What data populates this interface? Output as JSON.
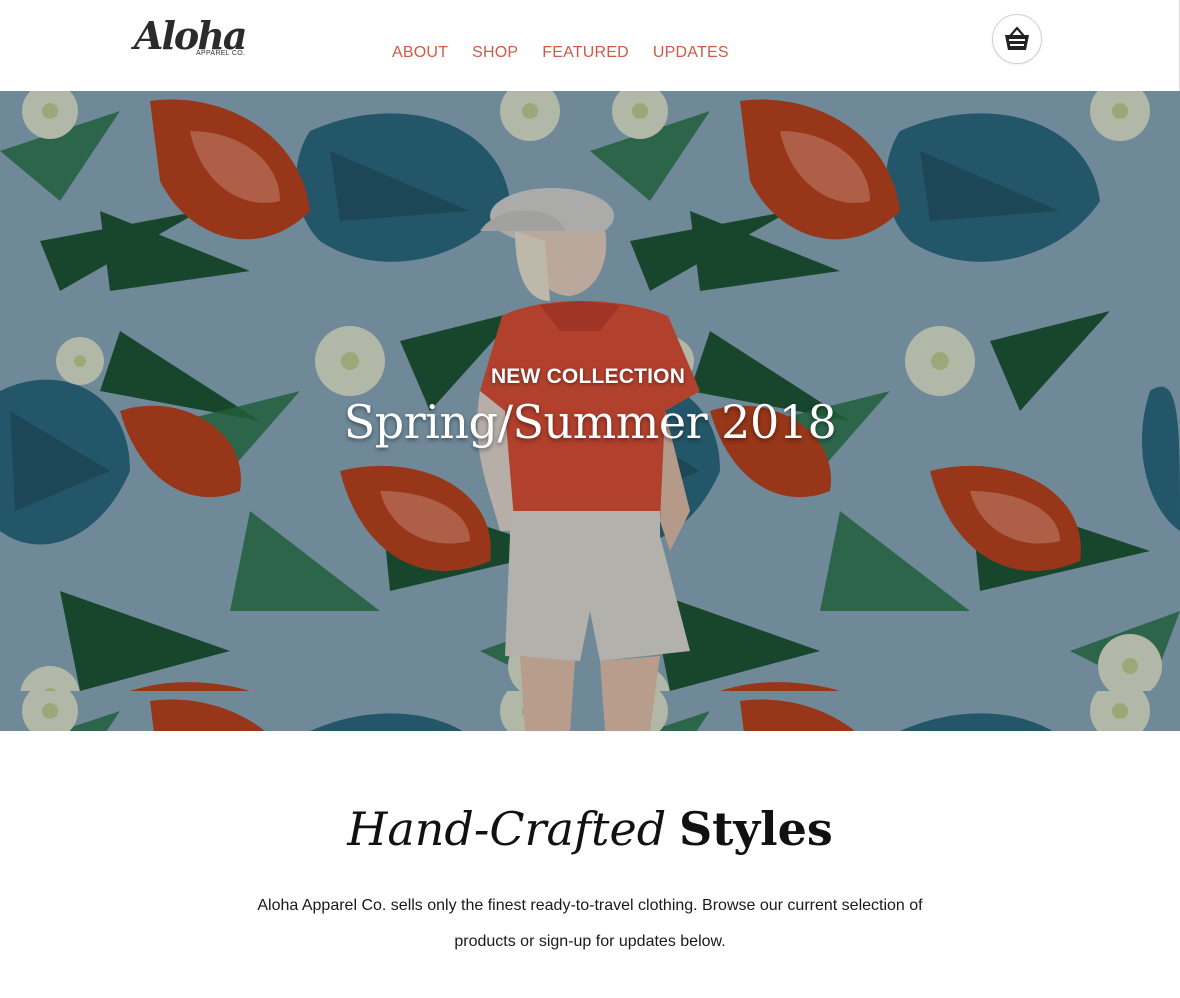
{
  "brand": {
    "name": "Aloha",
    "subtitle": "APPAREL CO."
  },
  "nav": {
    "items": [
      {
        "label": "ABOUT"
      },
      {
        "label": "SHOP"
      },
      {
        "label": "FEATURED"
      },
      {
        "label": "UPDATES"
      }
    ],
    "color": "#cf5a46"
  },
  "cart": {
    "icon": "shopping-basket-icon"
  },
  "hero": {
    "kicker": "NEW COLLECTION",
    "title": "Spring/Summer 2018",
    "background_color": "#8fb0c4"
  },
  "intro": {
    "title_italic": "Hand-Crafted",
    "title_bold": "Styles",
    "body": "Aloha Apparel Co. sells only the finest ready-to-travel clothing. Browse our current selection of products or sign-up for updates below."
  }
}
